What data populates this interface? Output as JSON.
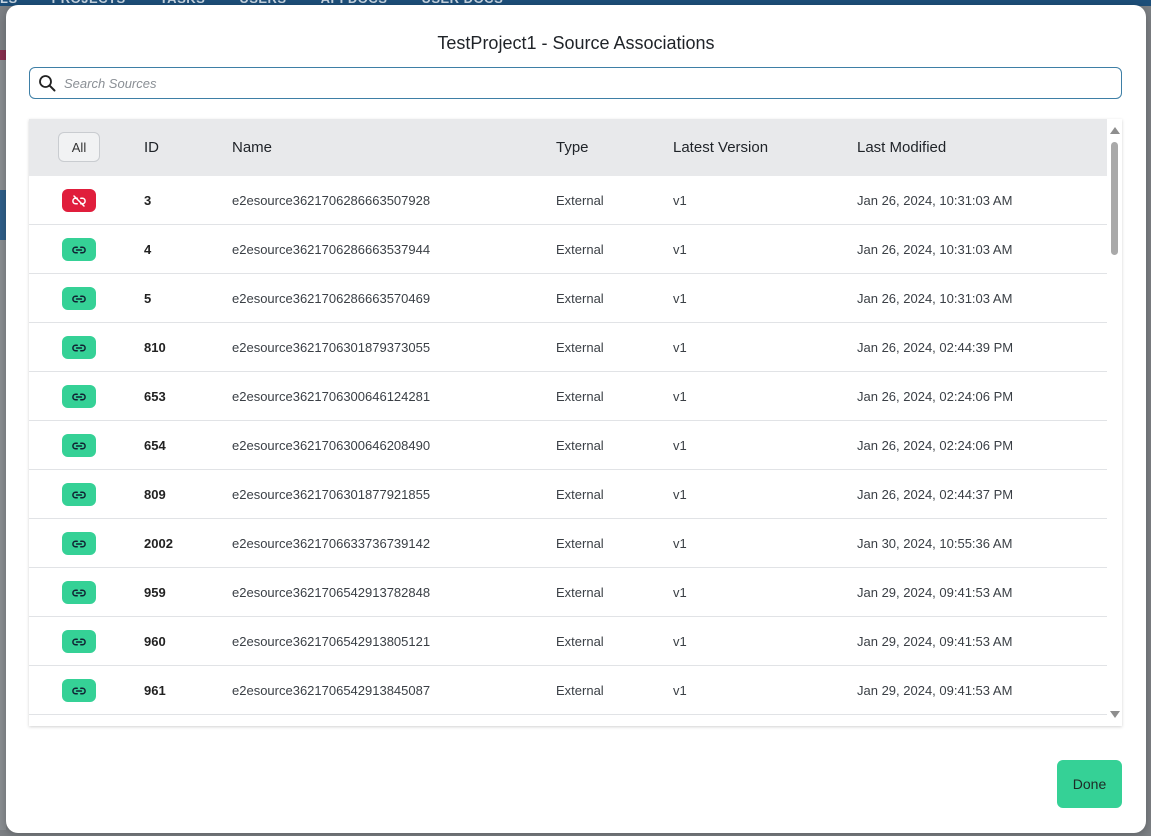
{
  "background": {
    "nav_items": [
      "LS",
      "PROJECTS",
      "TASKS",
      "USERS",
      "API DOCS",
      "USER DOCS"
    ]
  },
  "modal": {
    "title": "TestProject1 - Source Associations",
    "search": {
      "placeholder": "Search Sources",
      "value": "",
      "icon": "search-icon"
    },
    "table": {
      "select_all_label": "All",
      "columns": [
        "ID",
        "Name",
        "Type",
        "Latest Version",
        "Last Modified"
      ],
      "rows": [
        {
          "associated": false,
          "id": "3",
          "name": "e2esource3621706286663507928",
          "type": "External",
          "version": "v1",
          "modified": "Jan 26, 2024, 10:31:03 AM"
        },
        {
          "associated": true,
          "id": "4",
          "name": "e2esource3621706286663537944",
          "type": "External",
          "version": "v1",
          "modified": "Jan 26, 2024, 10:31:03 AM"
        },
        {
          "associated": true,
          "id": "5",
          "name": "e2esource3621706286663570469",
          "type": "External",
          "version": "v1",
          "modified": "Jan 26, 2024, 10:31:03 AM"
        },
        {
          "associated": true,
          "id": "810",
          "name": "e2esource3621706301879373055",
          "type": "External",
          "version": "v1",
          "modified": "Jan 26, 2024, 02:44:39 PM"
        },
        {
          "associated": true,
          "id": "653",
          "name": "e2esource3621706300646124281",
          "type": "External",
          "version": "v1",
          "modified": "Jan 26, 2024, 02:24:06 PM"
        },
        {
          "associated": true,
          "id": "654",
          "name": "e2esource3621706300646208490",
          "type": "External",
          "version": "v1",
          "modified": "Jan 26, 2024, 02:24:06 PM"
        },
        {
          "associated": true,
          "id": "809",
          "name": "e2esource3621706301877921855",
          "type": "External",
          "version": "v1",
          "modified": "Jan 26, 2024, 02:44:37 PM"
        },
        {
          "associated": true,
          "id": "2002",
          "name": "e2esource3621706633736739142",
          "type": "External",
          "version": "v1",
          "modified": "Jan 30, 2024, 10:55:36 AM"
        },
        {
          "associated": true,
          "id": "959",
          "name": "e2esource3621706542913782848",
          "type": "External",
          "version": "v1",
          "modified": "Jan 29, 2024, 09:41:53 AM"
        },
        {
          "associated": true,
          "id": "960",
          "name": "e2esource3621706542913805121",
          "type": "External",
          "version": "v1",
          "modified": "Jan 29, 2024, 09:41:53 AM"
        },
        {
          "associated": true,
          "id": "961",
          "name": "e2esource3621706542913845087",
          "type": "External",
          "version": "v1",
          "modified": "Jan 29, 2024, 09:41:53 AM"
        }
      ]
    },
    "done_label": "Done"
  },
  "colors": {
    "associated": "#35d196",
    "unassociated": "#e01e3c",
    "header_bg": "#e8e9eb",
    "search_border": "#3e7fa6"
  }
}
